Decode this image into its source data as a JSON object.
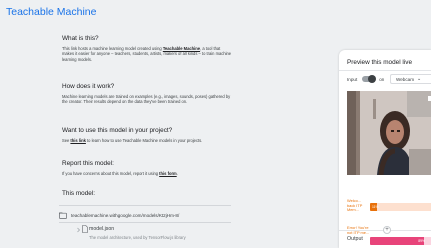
{
  "header": {
    "brand": "Teachable Machine"
  },
  "info": {
    "what": {
      "title": "What is this?",
      "body_pre": "This link hosts a machine learning model created using ",
      "link": "Teachable Machine",
      "body_post": ", a tool that makes it easier for anyone – teachers, students, artists, makers of all kinds – to train machine learning models."
    },
    "how": {
      "title": "How does it work?",
      "body": "Machine learning models are trained on examples (e.g., images, sounds, poses) gathered by the creator. Their results depend on the data they've been trained on."
    },
    "use": {
      "title": "Want to use this model in your project?",
      "body_pre": "See ",
      "link": "this link",
      "body_post": " to learn how to use Teachable Machine models in your projects."
    },
    "report": {
      "title": "Report this model:",
      "body_pre": "If you have concerns about this model, report it using ",
      "link": "this form",
      "body_post": "."
    },
    "model": {
      "title": "This model:",
      "url": "teachablemachine.withgoogle.com/models/Kt2jHm-8/",
      "file_name": "model.json",
      "file_desc": "The model architecture, used by TensorFlow.js library"
    }
  },
  "preview": {
    "title": "Preview this model live",
    "input_label": "Input",
    "toggle_state": "on",
    "source_select": "Webcam",
    "output_label": "Output",
    "classes": [
      {
        "label": "Welco... back ITP Mem...",
        "percent_label": "11%",
        "value": 0.11,
        "color": "#e8710a",
        "track": "#fde0cf"
      },
      {
        "label": "Error! You're not ITP me...",
        "percent_label": "89%",
        "value": 0.89,
        "color": "#e8447a",
        "track": "#fbd4e0"
      }
    ]
  },
  "colors": {
    "brand_blue": "#1a73e8",
    "orange": "#e8710a",
    "pink": "#e8447a",
    "background": "#eef0f2"
  },
  "icons": {
    "url": "folder-link-icon",
    "file": "document-icon",
    "flip": "camera-flip-icon",
    "add": "plus-icon"
  }
}
